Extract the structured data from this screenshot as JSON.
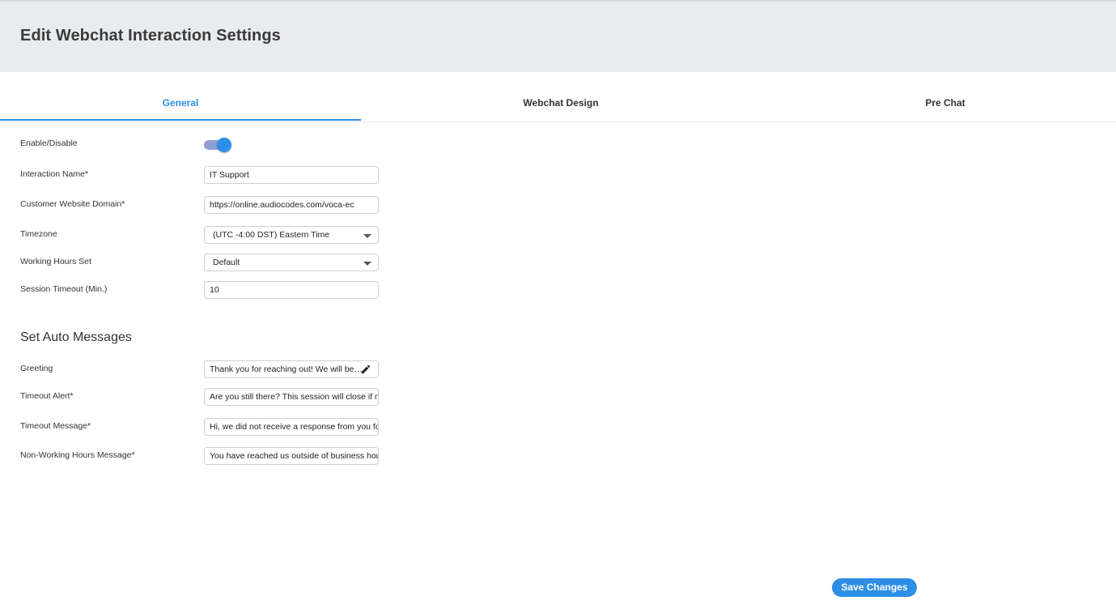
{
  "header": {
    "title": "Edit Webchat Interaction Settings"
  },
  "tabs": [
    {
      "label": "General",
      "active": true
    },
    {
      "label": "Webchat Design",
      "active": false
    },
    {
      "label": "Pre Chat",
      "active": false
    }
  ],
  "general": {
    "enable_label": "Enable/Disable",
    "enabled": true,
    "interaction_name": {
      "label": "Interaction Name*",
      "value": "IT Support"
    },
    "domain": {
      "label": "Customer Website Domain*",
      "value": "https://online.audiocodes.com/voca-ec"
    },
    "timezone": {
      "label": "Timezone",
      "value": "(UTC -4:00 DST) Eastern Time"
    },
    "working_hours": {
      "label": "Working Hours Set",
      "value": "Default"
    },
    "session_timeout": {
      "label": "Session Timeout (Min.)",
      "value": "10"
    }
  },
  "auto_messages": {
    "title": "Set Auto Messages",
    "greeting": {
      "label": "Greeting",
      "value": "Thank you for reaching out! We will be…"
    },
    "timeout_alert": {
      "label": "Timeout Alert*",
      "value": "Are you still there? This session will close if no"
    },
    "timeout_message": {
      "label": "Timeout Message*",
      "value": "Hi, we did not receive a response from you for"
    },
    "non_working": {
      "label": "Non-Working Hours Message*",
      "value": "You have reached us outside of business hours"
    }
  },
  "footer": {
    "save_label": "Save Changes"
  },
  "colors": {
    "accent": "#2d8ee6",
    "header_bg": "#e9ecef",
    "toggle_track": "#8f9fd6"
  }
}
